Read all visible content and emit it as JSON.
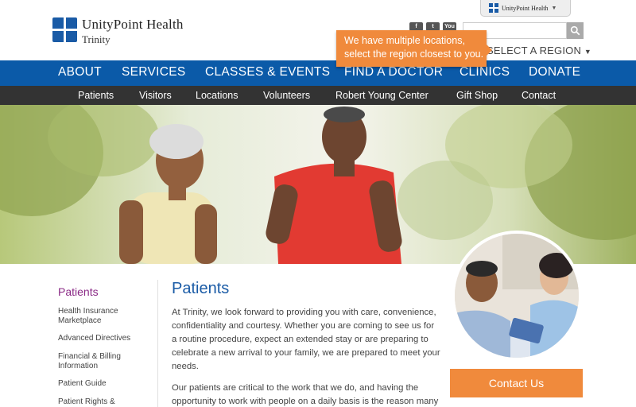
{
  "brand": {
    "title": "UnityPoint Health",
    "subtitle": "Trinity",
    "util_tab_label": "UnityPoint Health",
    "color": "#1a5ba6"
  },
  "header": {
    "social": [
      {
        "label": "f",
        "icon": "facebook-icon"
      },
      {
        "label": "t",
        "icon": "twitter-icon"
      },
      {
        "label": "You",
        "icon": "youtube-icon"
      }
    ],
    "search": {
      "placeholder": "",
      "value": "",
      "icon": "search-icon"
    },
    "region_label": "SELECT A REGION",
    "tooltip_text": "We have multiple locations, select the region closest to you."
  },
  "main_nav": [
    "ABOUT",
    "SERVICES",
    "CLASSES & EVENTS",
    "FIND A DOCTOR",
    "CLINICS",
    "DONATE"
  ],
  "sub_nav": [
    "Patients",
    "Visitors",
    "Locations",
    "Volunteers",
    "Robert Young Center",
    "Gift Shop",
    "Contact"
  ],
  "sidebar": {
    "title": "Patients",
    "links": [
      "Health Insurance Marketplace",
      "Advanced Directives",
      "Financial & Billing Information",
      "Patient Guide",
      "Patient Rights &"
    ]
  },
  "content": {
    "title": "Patients",
    "paragraphs": [
      "At Trinity, we look forward to providing you with care, convenience, confidentiality and courtesy. Whether you are coming to see us for a routine procedure, expect an extended stay or are preparing to celebrate a new arrival to your family, we are prepared to meet your needs.",
      "Our patients are critical to the work that we do, and having the opportunity to work with people on a daily basis is the reason many"
    ],
    "contact_button": "Contact Us"
  },
  "colors": {
    "nav_blue": "#0b5aa8",
    "sub_nav": "#333333",
    "accent_orange": "#f08a3c",
    "sidebar_title": "#8a2a86"
  }
}
